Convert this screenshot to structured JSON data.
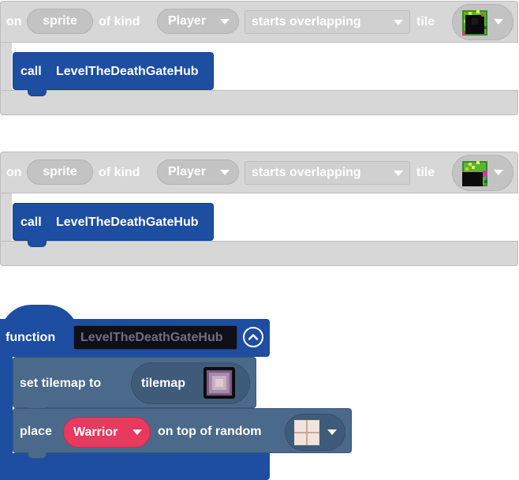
{
  "events": [
    {
      "on_label": "on",
      "sprite_label": "sprite",
      "of_kind_label": "of kind",
      "kind_value": "Player",
      "event_value": "starts overlapping",
      "tile_label": "tile",
      "tile_icon": "death-gate-tile-icon",
      "call_label": "call",
      "call_target": "LevelTheDeathGateHub"
    },
    {
      "on_label": "on",
      "sprite_label": "sprite",
      "of_kind_label": "of kind",
      "kind_value": "Player",
      "event_value": "starts overlapping",
      "tile_label": "tile",
      "tile_icon": "death-gate-tile-icon",
      "call_label": "call",
      "call_target": "LevelTheDeathGateHub"
    }
  ],
  "function_block": {
    "keyword": "function",
    "name": "LevelTheDeathGateHub",
    "collapse_icon": "chevron-up-icon",
    "statements": {
      "set_tilemap": {
        "label": "set tilemap to",
        "value_label": "tilemap",
        "thumb_icon": "tilemap-thumbnail-icon"
      },
      "place": {
        "label": "place",
        "kind_value": "Warrior",
        "suffix_label": "on top of random",
        "tile_icon": "floor-tile-icon"
      }
    }
  },
  "colors": {
    "disabled_block": "#d7d7d7",
    "function_blue": "#1d4ea1",
    "scene_slate": "#4b6a8b",
    "warrior_pink": "#e8395e"
  }
}
